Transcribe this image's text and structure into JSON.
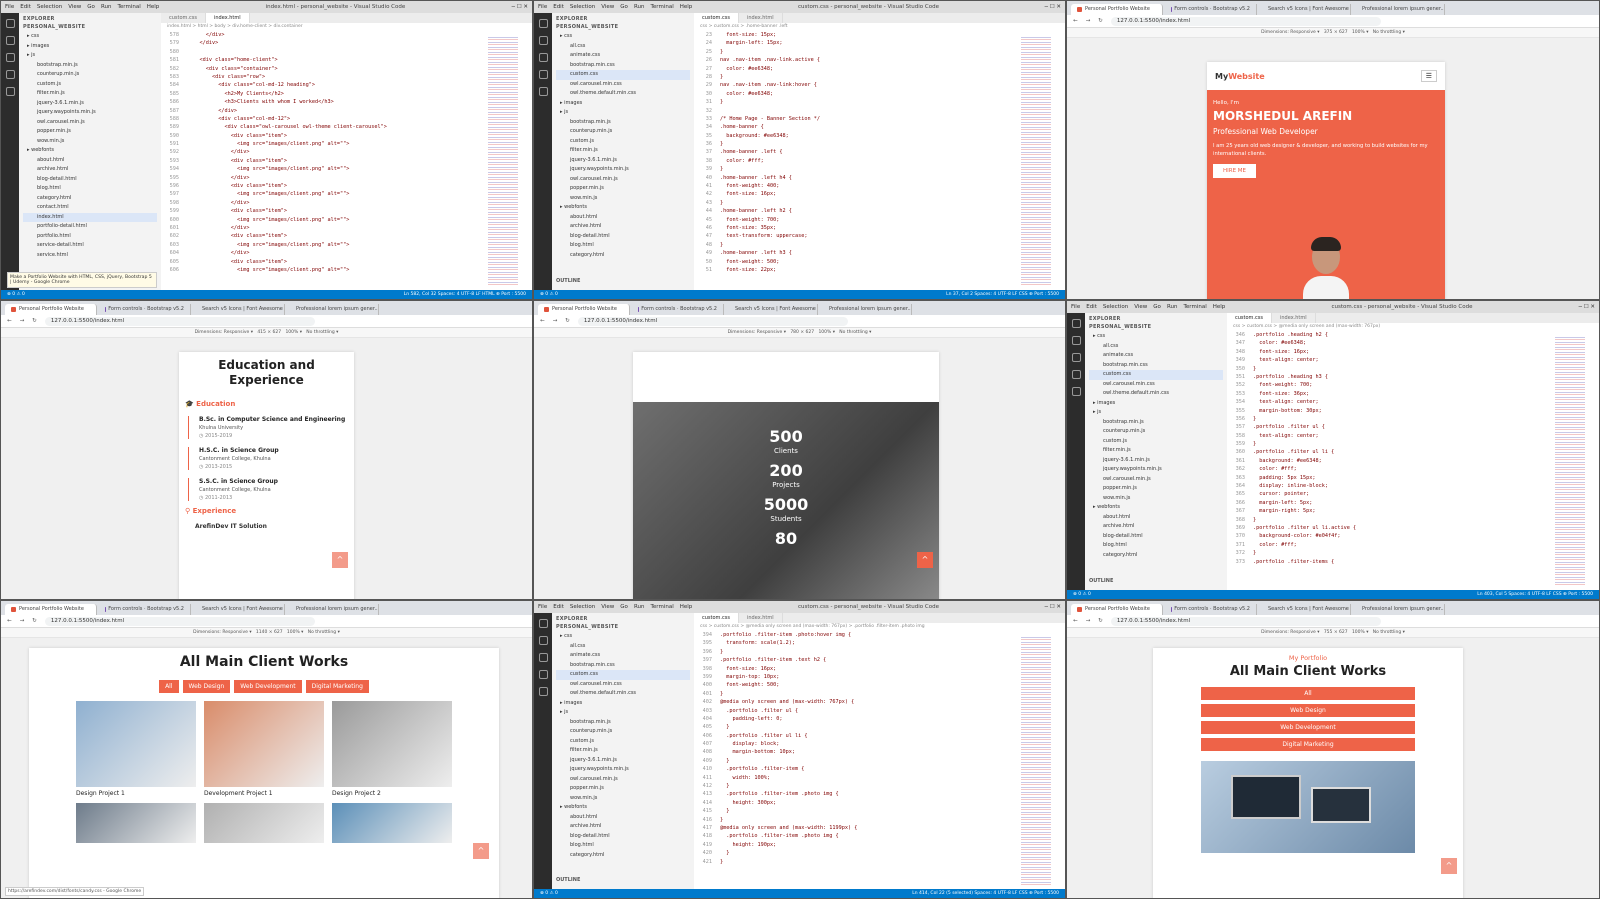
{
  "vscode1": {
    "title": "index.html - personal_website - Visual Studio Code",
    "menu": [
      "File",
      "Edit",
      "Selection",
      "View",
      "Go",
      "Run",
      "Terminal",
      "Help"
    ],
    "explorer_header": "EXPLORER",
    "project": "PERSONAL_WEBSITE",
    "files": [
      "css",
      "images",
      "js",
      "bootstrap.min.js",
      "counterup.min.js",
      "custom.js",
      "filter.min.js",
      "jquery-3.6.1.min.js",
      "jquery.waypoints.min.js",
      "owl.carousel.min.js",
      "popper.min.js",
      "wow.min.js",
      "webfonts",
      "about.html",
      "archive.html",
      "blog-detail.html",
      "blog.html",
      "category.html",
      "contact.html",
      "index.html",
      "portfolio-detail.html",
      "portfolio.html",
      "service-detail.html",
      "service.html"
    ],
    "outline": "OUTLINE",
    "tabs": [
      "custom.css",
      "index.html"
    ],
    "breadcrumb": "index.html > html > body > div.home-client > div.container",
    "lines": [
      {
        "n": "578",
        "t": "      </div>"
      },
      {
        "n": "579",
        "t": "    </div>"
      },
      {
        "n": "580",
        "t": ""
      },
      {
        "n": "581",
        "t": "    <div class=\"home-client\">"
      },
      {
        "n": "582",
        "t": "      <div class=\"container\">"
      },
      {
        "n": "583",
        "t": "        <div class=\"row\">"
      },
      {
        "n": "584",
        "t": "          <div class=\"col-md-12 heading\">"
      },
      {
        "n": "585",
        "t": "            <h2>My Clients</h2>"
      },
      {
        "n": "586",
        "t": "            <h3>Clients with whom I worked</h3>"
      },
      {
        "n": "587",
        "t": "          </div>"
      },
      {
        "n": "588",
        "t": "          <div class=\"col-md-12\">"
      },
      {
        "n": "589",
        "t": "            <div class=\"owl-carousel owl-theme client-carousel\">"
      },
      {
        "n": "590",
        "t": "              <div class=\"item\">"
      },
      {
        "n": "591",
        "t": "                <img src=\"images/client.png\" alt=\"\">"
      },
      {
        "n": "592",
        "t": "              </div>"
      },
      {
        "n": "593",
        "t": "              <div class=\"item\">"
      },
      {
        "n": "594",
        "t": "                <img src=\"images/client.png\" alt=\"\">"
      },
      {
        "n": "595",
        "t": "              </div>"
      },
      {
        "n": "596",
        "t": "              <div class=\"item\">"
      },
      {
        "n": "597",
        "t": "                <img src=\"images/client.png\" alt=\"\">"
      },
      {
        "n": "598",
        "t": "              </div>"
      },
      {
        "n": "599",
        "t": "              <div class=\"item\">"
      },
      {
        "n": "600",
        "t": "                <img src=\"images/client.png\" alt=\"\">"
      },
      {
        "n": "601",
        "t": "              </div>"
      },
      {
        "n": "602",
        "t": "              <div class=\"item\">"
      },
      {
        "n": "603",
        "t": "                <img src=\"images/client.png\" alt=\"\">"
      },
      {
        "n": "604",
        "t": "              </div>"
      },
      {
        "n": "605",
        "t": "              <div class=\"item\">"
      },
      {
        "n": "606",
        "t": "                <img src=\"images/client.png\" alt=\"\">"
      }
    ],
    "tooltip": "Make a Portfolio Website with HTML, CSS, jQuery, Bootstrap 5 | Udemy - Google Chrome",
    "status_left": "⊗ 0 ⚠ 0",
    "status_right": "Ln 582, Col 32   Spaces: 4   UTF-8   LF   HTML   ⊕ Port : 5500"
  },
  "vscode2": {
    "title": "custom.css - personal_website - Visual Studio Code",
    "tabs": [
      "custom.css",
      "index.html"
    ],
    "breadcrumb": "css > custom.css > .home-banner .left",
    "files": [
      "css",
      "all.css",
      "animate.css",
      "bootstrap.min.css",
      "custom.css",
      "owl.carousel.min.css",
      "owl.theme.default.min.css",
      "images",
      "js",
      "bootstrap.min.js",
      "counterup.min.js",
      "custom.js",
      "filter.min.js",
      "jquery-3.6.1.min.js",
      "jquery.waypoints.min.js",
      "owl.carousel.min.js",
      "popper.min.js",
      "wow.min.js",
      "webfonts",
      "about.html",
      "archive.html",
      "blog-detail.html",
      "blog.html",
      "category.html"
    ],
    "lines": [
      {
        "n": "23",
        "t": "  font-size: 15px;"
      },
      {
        "n": "24",
        "t": "  margin-left: 15px;"
      },
      {
        "n": "25",
        "t": "}"
      },
      {
        "n": "26",
        "t": "nav .nav-item .nav-link.active {"
      },
      {
        "n": "27",
        "t": "  color: #ee6348;"
      },
      {
        "n": "28",
        "t": "}"
      },
      {
        "n": "29",
        "t": "nav .nav-item .nav-link:hover {"
      },
      {
        "n": "30",
        "t": "  color: #ee6348;"
      },
      {
        "n": "31",
        "t": "}"
      },
      {
        "n": "32",
        "t": ""
      },
      {
        "n": "33",
        "t": "/* Home Page - Banner Section */"
      },
      {
        "n": "34",
        "t": ".home-banner {"
      },
      {
        "n": "35",
        "t": "  background: #ee6348;"
      },
      {
        "n": "36",
        "t": "}"
      },
      {
        "n": "37",
        "t": ".home-banner .left {"
      },
      {
        "n": "38",
        "t": "  color: #fff;"
      },
      {
        "n": "39",
        "t": "}"
      },
      {
        "n": "40",
        "t": ".home-banner .left h4 {"
      },
      {
        "n": "41",
        "t": "  font-weight: 400;"
      },
      {
        "n": "42",
        "t": "  font-size: 16px;"
      },
      {
        "n": "43",
        "t": "}"
      },
      {
        "n": "44",
        "t": ".home-banner .left h2 {"
      },
      {
        "n": "45",
        "t": "  font-weight: 700;"
      },
      {
        "n": "46",
        "t": "  font-size: 35px;"
      },
      {
        "n": "47",
        "t": "  text-transform: uppercase;"
      },
      {
        "n": "48",
        "t": "}"
      },
      {
        "n": "49",
        "t": ".home-banner .left h3 {"
      },
      {
        "n": "50",
        "t": "  font-weight: 500;"
      },
      {
        "n": "51",
        "t": "  font-size: 22px;"
      }
    ],
    "status_right": "Ln 37, Col 2   Spaces: 4   UTF-8   LF   CSS   ⊕ Port : 5500"
  },
  "browser_tabs": [
    "Personal Portfolio Website",
    "Form controls · Bootstrap v5.2",
    "Search v5 Icons | Font Awesome",
    "Professional lorem ipsum gener..."
  ],
  "url": "127.0.0.1:5500/index.html",
  "devtools": {
    "dimensions": "Dimensions: Responsive ▾",
    "zoom": "100% ▾",
    "throttle": "No throttling ▾"
  },
  "chrome3": {
    "width": "375",
    "height": "627",
    "logo_my": "My",
    "logo_site": "Website",
    "hello": "Hello, I'm",
    "name": "MORSHEDUL AREFIN",
    "role": "Professional Web Developer",
    "intro": "I am 25 years old web designer & developer, and working to build websites for my international clients.",
    "hire": "HIRE ME"
  },
  "chrome4": {
    "width": "415",
    "height": "627",
    "heading": "Education and Experience",
    "edu_title": "Education",
    "edu": [
      {
        "title": "B.Sc. in Computer Science and Engineering",
        "place": "Khulna University",
        "years": "2015-2019"
      },
      {
        "title": "H.S.C. in Science Group",
        "place": "Cantonment College, Khulna",
        "years": "2013-2015"
      },
      {
        "title": "S.S.C. in Science Group",
        "place": "Cantonment College, Khulna",
        "years": "2011-2013"
      }
    ],
    "exp_title": "Experience",
    "exp_first": "ArefinDev IT Solution"
  },
  "chrome5": {
    "width": "780",
    "height": "627",
    "counters": [
      {
        "num": "500",
        "label": "Clients"
      },
      {
        "num": "200",
        "label": "Projects"
      },
      {
        "num": "5000",
        "label": "Students"
      },
      {
        "num": "80",
        "label": ""
      }
    ]
  },
  "vscode6": {
    "title": "custom.css - personal_website - Visual Studio Code",
    "breadcrumb": "css > custom.css > @media only screen and (max-width: 767px)",
    "files": [
      "css",
      "all.css",
      "animate.css",
      "bootstrap.min.css",
      "custom.css",
      "owl.carousel.min.css",
      "owl.theme.default.min.css",
      "images",
      "js",
      "bootstrap.min.js",
      "counterup.min.js",
      "custom.js",
      "filter.min.js",
      "jquery-3.6.1.min.js",
      "jquery.waypoints.min.js",
      "owl.carousel.min.js",
      "popper.min.js",
      "wow.min.js",
      "webfonts",
      "about.html",
      "archive.html",
      "blog-detail.html",
      "blog.html",
      "category.html"
    ],
    "lines": [
      {
        "n": "346",
        "t": ".portfolio .heading h2 {"
      },
      {
        "n": "347",
        "t": "  color: #ee6348;"
      },
      {
        "n": "348",
        "t": "  font-size: 16px;"
      },
      {
        "n": "349",
        "t": "  text-align: center;"
      },
      {
        "n": "350",
        "t": "}"
      },
      {
        "n": "351",
        "t": ".portfolio .heading h3 {"
      },
      {
        "n": "352",
        "t": "  font-weight: 700;"
      },
      {
        "n": "353",
        "t": "  font-size: 36px;"
      },
      {
        "n": "354",
        "t": "  text-align: center;"
      },
      {
        "n": "355",
        "t": "  margin-bottom: 30px;"
      },
      {
        "n": "356",
        "t": "}"
      },
      {
        "n": "357",
        "t": ".portfolio .filter ul {"
      },
      {
        "n": "358",
        "t": "  text-align: center;"
      },
      {
        "n": "359",
        "t": "}"
      },
      {
        "n": "360",
        "t": ".portfolio .filter ul li {"
      },
      {
        "n": "361",
        "t": "  background: #ee6348;"
      },
      {
        "n": "362",
        "t": "  color: #fff;"
      },
      {
        "n": "363",
        "t": "  padding: 5px 15px;"
      },
      {
        "n": "364",
        "t": "  display: inline-block;"
      },
      {
        "n": "365",
        "t": "  cursor: pointer;"
      },
      {
        "n": "366",
        "t": "  margin-left: 5px;"
      },
      {
        "n": "367",
        "t": "  margin-right: 5px;"
      },
      {
        "n": "368",
        "t": "}"
      },
      {
        "n": "369",
        "t": ".portfolio .filter ul li.active {"
      },
      {
        "n": "370",
        "t": "  background-color: #e04f4f;"
      },
      {
        "n": "371",
        "t": "  color: #fff;"
      },
      {
        "n": "372",
        "t": "}"
      },
      {
        "n": "373",
        "t": ".portfolio .filter-items {"
      }
    ],
    "status_right": "Ln 403, Col 5   Spaces: 4   UTF-8   LF   CSS   ⊕ Port : 5500"
  },
  "chrome7": {
    "width": "1140",
    "height": "627",
    "heading": "All Main Client Works",
    "filters": [
      "All",
      "Web Design",
      "Web Development",
      "Digital Marketing"
    ],
    "projects": [
      "Design Project 1",
      "Development Project 1",
      "Design Project 2"
    ],
    "status": "https://arefindev.com/dist/fonts/candy.css - Google Chrome"
  },
  "vscode8": {
    "title": "custom.css - personal_website - Visual Studio Code",
    "breadcrumb": "css > custom.css > @media only screen and (max-width: 767px) > .portfolio .filter-item .photo img",
    "lines": [
      {
        "n": "394",
        "t": ".portfolio .filter-item .photo:hover img {"
      },
      {
        "n": "395",
        "t": "  transform: scale(1.2);"
      },
      {
        "n": "396",
        "t": "}"
      },
      {
        "n": "397",
        "t": ".portfolio .filter-item .text h2 {"
      },
      {
        "n": "398",
        "t": "  font-size: 16px;"
      },
      {
        "n": "399",
        "t": "  margin-top: 10px;"
      },
      {
        "n": "400",
        "t": "  font-weight: 500;"
      },
      {
        "n": "401",
        "t": "}"
      },
      {
        "n": "402",
        "t": "@media only screen and (max-width: 767px) {"
      },
      {
        "n": "403",
        "t": "  .portfolio .filter ul {"
      },
      {
        "n": "404",
        "t": "    padding-left: 0;"
      },
      {
        "n": "405",
        "t": "  }"
      },
      {
        "n": "406",
        "t": "  .portfolio .filter ul li {"
      },
      {
        "n": "407",
        "t": "    display: block;"
      },
      {
        "n": "408",
        "t": "    margin-bottom: 10px;"
      },
      {
        "n": "409",
        "t": "  }"
      },
      {
        "n": "410",
        "t": "  .portfolio .filter-item {"
      },
      {
        "n": "411",
        "t": "    width: 100%;"
      },
      {
        "n": "412",
        "t": "  }"
      },
      {
        "n": "413",
        "t": "  .portfolio .filter-item .photo img {"
      },
      {
        "n": "414",
        "t": "    height: 300px;"
      },
      {
        "n": "415",
        "t": "  }"
      },
      {
        "n": "416",
        "t": "}"
      },
      {
        "n": "417",
        "t": "@media only screen and (max-width: 1199px) {"
      },
      {
        "n": "418",
        "t": "  .portfolio .filter-item .photo img {"
      },
      {
        "n": "419",
        "t": "    height: 190px;"
      },
      {
        "n": "420",
        "t": "  }"
      },
      {
        "n": "421",
        "t": "}"
      }
    ],
    "status_right": "Ln 414, Col 22 (5 selected)   Spaces: 4   UTF-8   LF   CSS   ⊕ Port : 5500"
  },
  "chrome9": {
    "width": "755",
    "height": "627",
    "kicker": "My Portfolio",
    "heading": "All Main Client Works",
    "filters": [
      "All",
      "Web Design",
      "Web Development",
      "Digital Marketing"
    ]
  }
}
